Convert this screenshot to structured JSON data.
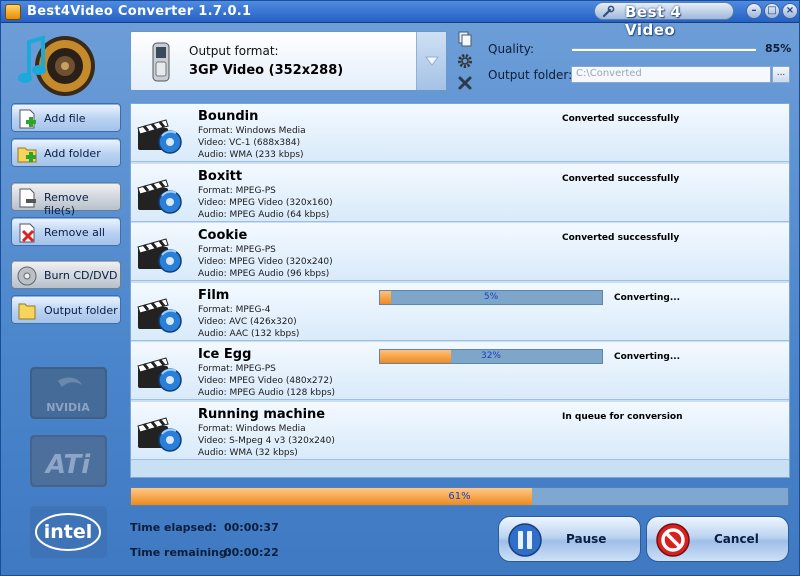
{
  "window": {
    "title": "Best4Video Converter 1.7.0.1",
    "brand": "Best 4 Video",
    "buttons": {
      "minimize": "–",
      "maximize": "□",
      "close": "×"
    }
  },
  "output": {
    "format_label": "Output format:",
    "format_value": "3GP Video (352x288)",
    "quality_label": "Quality:",
    "quality_value": "85%",
    "quality_level": 0.85,
    "folder_label": "Output folder:",
    "folder_value": "C:\\Converted",
    "browse_label": "..."
  },
  "sidebar": {
    "add_file": "Add file",
    "add_folder": "Add folder",
    "remove_files": "Remove file(s)",
    "remove_all": "Remove all",
    "burn": "Burn CD/DVD",
    "output_folder": "Output folder"
  },
  "vendors": [
    "NVIDIA",
    "ATi",
    "intel"
  ],
  "files": [
    {
      "name": "Boundin",
      "format": "Format: Windows Media",
      "video": "Video: VC-1 (688x384)",
      "audio": "Audio: WMA (233 kbps)",
      "status": "Converted successfully"
    },
    {
      "name": "Boxitt",
      "format": "Format: MPEG-PS",
      "video": "Video: MPEG Video (320x160)",
      "audio": "Audio: MPEG Audio (64 kbps)",
      "status": "Converted successfully"
    },
    {
      "name": "Cookie",
      "format": "Format: MPEG-PS",
      "video": "Video: MPEG Video (320x240)",
      "audio": "Audio: MPEG Audio (96 kbps)",
      "status": "Converted successfully"
    },
    {
      "name": "Film",
      "format": "Format: MPEG-4",
      "video": "Video: AVC (426x320)",
      "audio": "Audio: AAC (132 kbps)",
      "status": "Converting...",
      "progress": 5,
      "progress_label": "5%"
    },
    {
      "name": "Ice Egg",
      "format": "Format: MPEG-PS",
      "video": "Video: MPEG Video (480x272)",
      "audio": "Audio: MPEG Audio (128 kbps)",
      "status": "Converting...",
      "progress": 32,
      "progress_label": "32%"
    },
    {
      "name": "Running machine",
      "format": "Format: Windows Media",
      "video": "Video: S-Mpeg 4 v3 (320x240)",
      "audio": "Audio: WMA (32 kbps)",
      "status": "In queue for conversion"
    }
  ],
  "overall": {
    "progress": 61,
    "label": "61%"
  },
  "times": {
    "elapsed_label": "Time elapsed:",
    "elapsed_value": "00:00:37",
    "remaining_label": "Time remaining:",
    "remaining_value": "00:00:22"
  },
  "actions": {
    "pause": "Pause",
    "cancel": "Cancel"
  },
  "colors": {
    "accent_orange": "#f08a1e",
    "panel_blue": "#4b86cc",
    "progress_text": "#1b3ec0"
  }
}
